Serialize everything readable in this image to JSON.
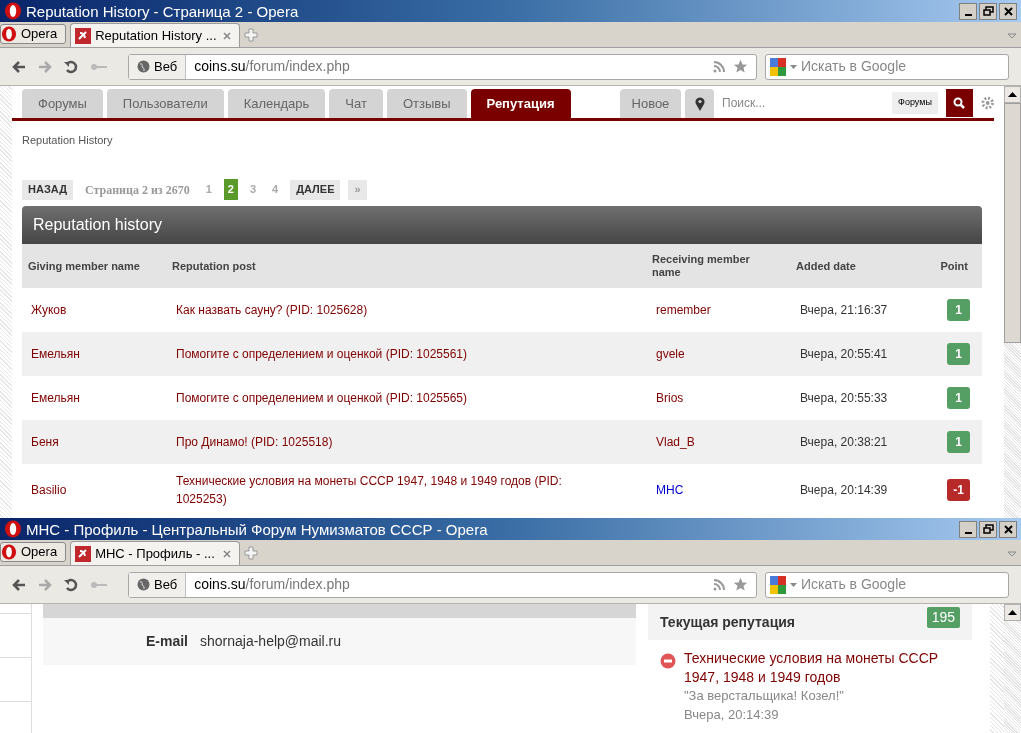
{
  "top_window": {
    "title": "Reputation History - Страница 2 - Opera",
    "menu_button": "Opera",
    "tabs": [
      {
        "label": "Reputation History ...",
        "selected": true
      }
    ],
    "address": {
      "host": "coins.su",
      "path": "/forum/index.php"
    },
    "mode_label": "Веб",
    "search_placeholder": "Искать в Google",
    "page": {
      "nav_tabs": [
        {
          "label": "Форумы",
          "selected": false
        },
        {
          "label": "Пользователи",
          "selected": false
        },
        {
          "label": "Календарь",
          "selected": false
        },
        {
          "label": "Чат",
          "selected": false
        },
        {
          "label": "Отзывы",
          "selected": false
        },
        {
          "label": "Репутация",
          "selected": true
        }
      ],
      "new_label": "Новое",
      "search_placeholder": "Поиск...",
      "search_scope": "Форумы",
      "breadcrumb": "Reputation History",
      "pagination": {
        "back": "НАЗАД",
        "info": "Страница 2 из 2670",
        "pages": [
          {
            "label": "1",
            "selected": false
          },
          {
            "label": "2",
            "selected": true
          },
          {
            "label": "3",
            "selected": false
          },
          {
            "label": "4",
            "selected": false
          }
        ],
        "next": "ДАЛЕЕ",
        "last": "»"
      },
      "table": {
        "title": "Reputation history",
        "columns": [
          "Giving member name",
          "Reputation post",
          "Receiving member name",
          "Added date",
          "Point"
        ],
        "rows": [
          {
            "giver": "Жуков",
            "post": "Как назвать сауну? (PID: 1025628)",
            "receiver": "remember",
            "color": "#800000",
            "date": "Вчера, 21:16:37",
            "point": "1",
            "kind": "positive"
          },
          {
            "giver": "Емельян",
            "post": "Помогите с определением и оценкой (PID: 1025561)",
            "receiver": "gvele",
            "color": "#800000",
            "date": "Вчера, 20:55:41",
            "point": "1",
            "kind": "positive"
          },
          {
            "giver": "Емельян",
            "post": "Помогите с определением и оценкой (PID: 1025565)",
            "receiver": "Brios",
            "color": "#800000",
            "date": "Вчера, 20:55:33",
            "point": "1",
            "kind": "positive"
          },
          {
            "giver": "Беня",
            "post": "Про Динамо! (PID: 1025518)",
            "receiver": "Vlad_B",
            "color": "#800000",
            "date": "Вчера, 20:38:21",
            "point": "1",
            "kind": "positive"
          },
          {
            "giver": "Basilio",
            "post": "Технические условия на монеты СССР 1947, 1948 и 1949 годов (PID: 1025253)",
            "receiver": "MHC",
            "color": "#0000cc",
            "date": "Вчера, 20:14:39",
            "point": "-1",
            "kind": "negative"
          }
        ]
      }
    }
  },
  "bottom_window": {
    "title": "МНС - Профиль - Центральный Форум Нумизматов СССР - Opera",
    "menu_button": "Opera",
    "tabs": [
      {
        "label": "МНС - Профиль - ...",
        "selected": true
      }
    ],
    "address": {
      "host": "coins.su",
      "path": "/forum/index.php"
    },
    "mode_label": "Веб",
    "search_placeholder": "Искать в Google",
    "page": {
      "email_label": "E-mail",
      "email_value": "shornaja-help@mail.ru",
      "reputation": {
        "title": "Текущая репутация",
        "count": "195",
        "entries": [
          {
            "title": "Технические условия на монеты СССР 1947, 1948 и 1949 годов",
            "quote": "\"За верстальщика! Козел!\"",
            "date": "Вчера, 20:14:39",
            "kind": "negative"
          }
        ]
      }
    }
  }
}
